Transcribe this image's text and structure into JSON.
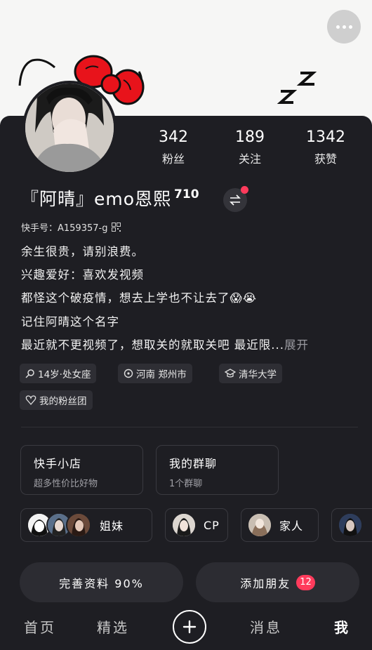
{
  "profile": {
    "nickname": "『阿晴』emo恩熙",
    "level": "710",
    "kuaishou_id": "快手号：A159357-g",
    "bio": [
      "余生很贵，请别浪费。",
      "兴趣爱好：喜欢发视频",
      "都怪这个破疫情，想去上学也不让去了😱😭",
      "记住阿晴这个名字",
      "最近就不更视频了，想取关的就取关吧 最近限..."
    ],
    "expand_label": "展开"
  },
  "stats": [
    {
      "value": "342",
      "label": "粉丝"
    },
    {
      "value": "189",
      "label": "关注"
    },
    {
      "value": "1342",
      "label": "获赞"
    }
  ],
  "tags": {
    "age": "14岁·处女座",
    "location": "河南 郑州市",
    "school": "清华大学",
    "fan_group": "我的粉丝团"
  },
  "cards": {
    "shop": {
      "title": "快手小店",
      "subtitle": "超多性价比好物"
    },
    "chat": {
      "title": "我的群聊",
      "subtitle": "1个群聊"
    }
  },
  "groups": [
    {
      "label": "姐妹"
    },
    {
      "label": "CP"
    },
    {
      "label": "家人"
    }
  ],
  "buttons": {
    "complete_profile": "完善资料 90%",
    "add_friends": "添加朋友",
    "add_friends_badge": "12"
  },
  "tabbar": {
    "home": "首页",
    "featured": "精选",
    "messages": "消息",
    "me": "我"
  },
  "icons": [
    "more-icon",
    "switch-account-icon",
    "qr-code-icon",
    "search-icon",
    "location-icon",
    "school-icon",
    "heart-icon",
    "plus-icon"
  ],
  "colors": {
    "accent": "#ff3b5c",
    "background": "#1e1e23",
    "banner": "#f6f6f5"
  }
}
